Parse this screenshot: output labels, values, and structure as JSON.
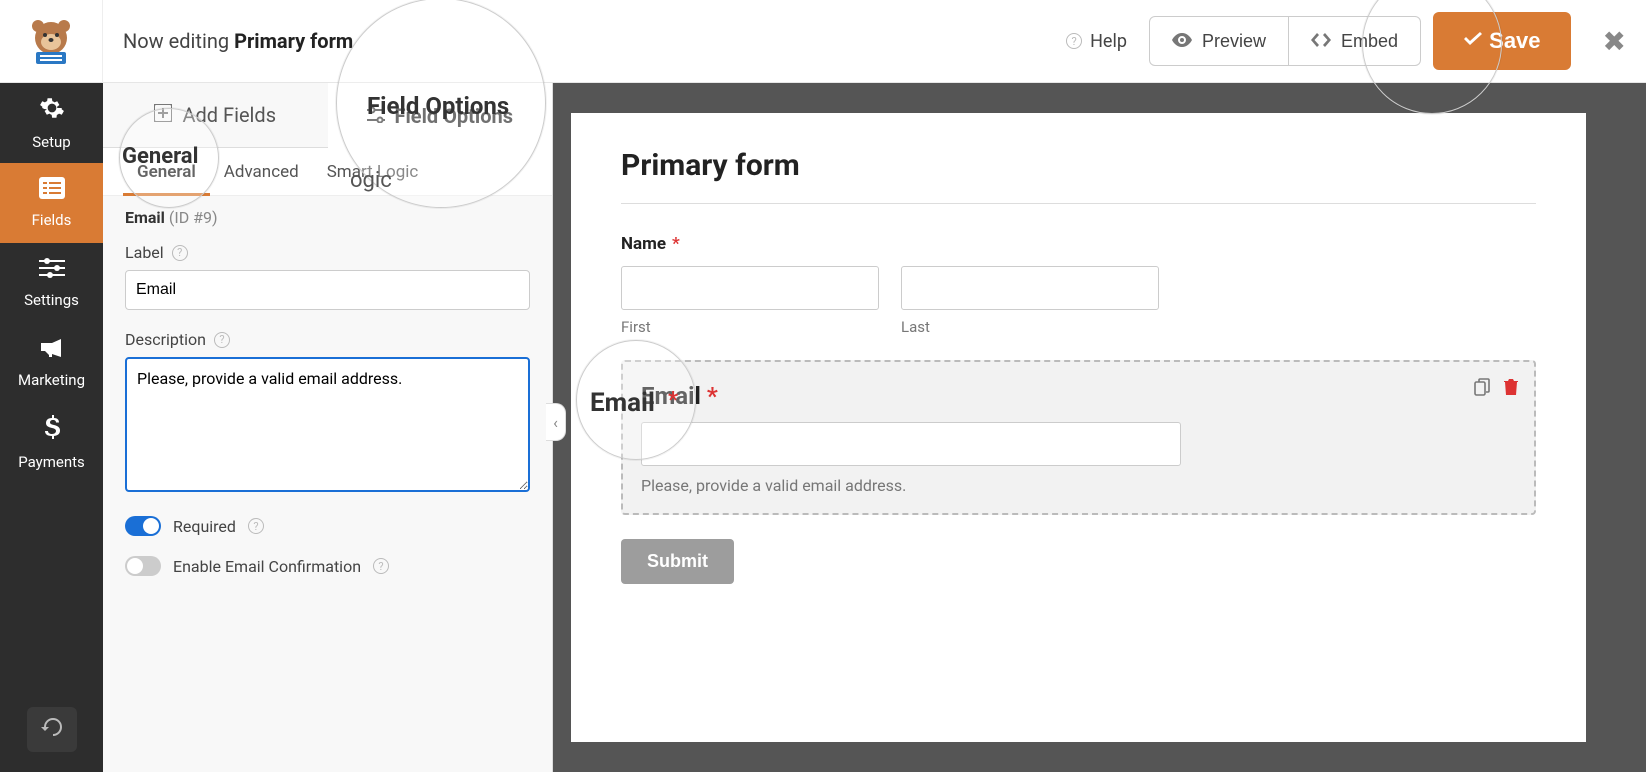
{
  "header": {
    "editing_prefix": "Now editing",
    "form_name": "Primary form",
    "help": "Help",
    "preview": "Preview",
    "embed": "Embed",
    "save": "Save"
  },
  "sidebar": {
    "items": [
      {
        "label": "Setup"
      },
      {
        "label": "Fields"
      },
      {
        "label": "Settings"
      },
      {
        "label": "Marketing"
      },
      {
        "label": "Payments"
      }
    ]
  },
  "panel": {
    "tab_add_fields": "Add Fields",
    "tab_field_options": "Field Options",
    "subtabs": {
      "general": "General",
      "advanced": "Advanced",
      "smart_logic": "Smart Logic"
    },
    "field": {
      "name": "Email",
      "id_label": "(ID #9)",
      "label_label": "Label",
      "label_value": "Email",
      "description_label": "Description",
      "description_value": "Please, provide a valid email address.",
      "required_label": "Required",
      "confirmation_label": "Enable Email Confirmation"
    }
  },
  "preview": {
    "title": "Primary form",
    "name_label": "Name",
    "first_sub": "First",
    "last_sub": "Last",
    "email_label": "Email",
    "email_desc": "Please, provide a valid email address.",
    "submit": "Submit"
  },
  "zoom": {
    "field_options": "Field Options",
    "general": "General",
    "advanced": "ogic",
    "email": "Email"
  }
}
